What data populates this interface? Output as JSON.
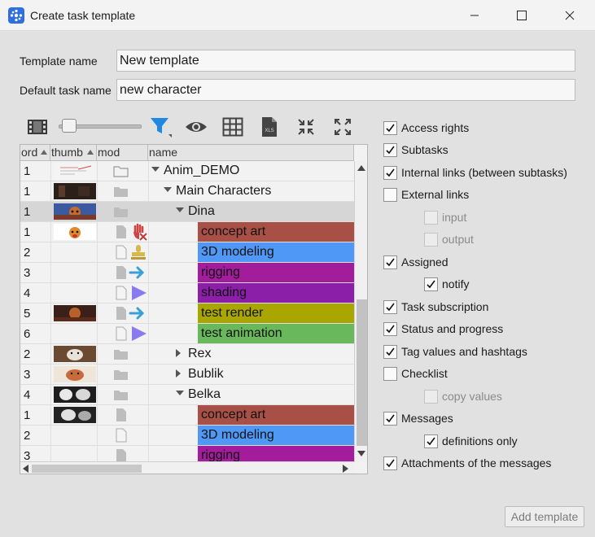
{
  "window": {
    "title": "Create task template"
  },
  "form": {
    "template_name_label": "Template name",
    "template_name_value": "New template",
    "default_task_label": "Default task name",
    "default_task_value": "new character"
  },
  "tree": {
    "columns": [
      "ord",
      "thumb",
      "mod",
      "name"
    ],
    "rows": [
      {
        "ord": "1",
        "name": "Anim_DEMO",
        "kind": "folder",
        "level": 0,
        "expand": "down"
      },
      {
        "ord": "1",
        "name": "Main Characters",
        "kind": "folder",
        "level": 1,
        "expand": "down"
      },
      {
        "ord": "1",
        "name": "Dina",
        "kind": "folder",
        "level": 2,
        "expand": "down",
        "selected": true
      },
      {
        "ord": "1",
        "name": "concept art",
        "kind": "task",
        "color": "#a85046"
      },
      {
        "ord": "2",
        "name": "3D modeling",
        "kind": "task",
        "color": "#4f98f5"
      },
      {
        "ord": "3",
        "name": "rigging",
        "kind": "task",
        "color": "#a21c9c"
      },
      {
        "ord": "4",
        "name": "shading",
        "kind": "task",
        "color": "#8b1fa8"
      },
      {
        "ord": "5",
        "name": "test render",
        "kind": "task",
        "color": "#aaa600"
      },
      {
        "ord": "6",
        "name": "test animation",
        "kind": "task",
        "color": "#6ab85c"
      },
      {
        "ord": "2",
        "name": "Rex",
        "kind": "folder",
        "level": 2,
        "expand": "right"
      },
      {
        "ord": "3",
        "name": "Bublik",
        "kind": "folder",
        "level": 2,
        "expand": "right"
      },
      {
        "ord": "4",
        "name": "Belka",
        "kind": "folder",
        "level": 2,
        "expand": "down"
      },
      {
        "ord": "1",
        "name": "concept art",
        "kind": "task",
        "color": "#a85046"
      },
      {
        "ord": "2",
        "name": "3D modeling",
        "kind": "task",
        "color": "#4f98f5"
      },
      {
        "ord": "3",
        "name": "rigging",
        "kind": "task",
        "color": "#a21c9c"
      }
    ]
  },
  "options": [
    {
      "label": "Access rights",
      "checked": true,
      "indent": false,
      "disabled": false
    },
    {
      "label": "Subtasks",
      "checked": true,
      "indent": false,
      "disabled": false
    },
    {
      "label": "Internal links (between subtasks)",
      "checked": true,
      "indent": false,
      "disabled": false
    },
    {
      "label": "External links",
      "checked": false,
      "indent": false,
      "disabled": false
    },
    {
      "label": "input",
      "checked": false,
      "indent": true,
      "disabled": true
    },
    {
      "label": "output",
      "checked": false,
      "indent": true,
      "disabled": true
    },
    {
      "label": "Assigned",
      "checked": true,
      "indent": false,
      "disabled": false
    },
    {
      "label": "notify",
      "checked": true,
      "indent": true,
      "disabled": false
    },
    {
      "label": "Task subscription",
      "checked": true,
      "indent": false,
      "disabled": false
    },
    {
      "label": "Status and progress",
      "checked": true,
      "indent": false,
      "disabled": false
    },
    {
      "label": "Tag values and hashtags",
      "checked": true,
      "indent": false,
      "disabled": false
    },
    {
      "label": "Checklist",
      "checked": false,
      "indent": false,
      "disabled": false
    },
    {
      "label": "copy values",
      "checked": false,
      "indent": true,
      "disabled": true
    },
    {
      "label": "Messages",
      "checked": true,
      "indent": false,
      "disabled": false
    },
    {
      "label": "definitions only",
      "checked": true,
      "indent": true,
      "disabled": false
    },
    {
      "label": "Attachments of the messages",
      "checked": true,
      "indent": false,
      "disabled": false
    }
  ],
  "toolbar": {
    "xls_label": "XLS"
  },
  "actions": {
    "add_template": "Add template"
  },
  "colors": {
    "filter_accent": "#1e88e5",
    "selected_row": "#d6d6d6"
  }
}
